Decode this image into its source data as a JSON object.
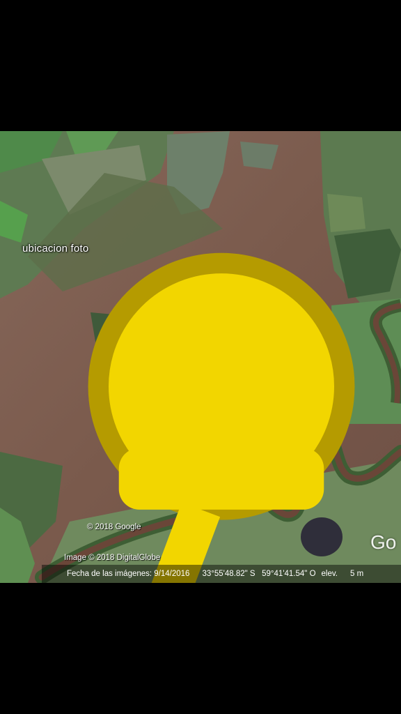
{
  "placemark": {
    "label": "ubicacion foto",
    "icon": "yellow-pushpin-icon"
  },
  "credits": {
    "google": "© 2018 Google",
    "imagery": "Image © 2018 DigitalGlobe"
  },
  "status_bar": {
    "date": "Fecha de las imágenes: 9/14/2016",
    "coordinates": "33°55'48.82\" S   59°41'41.54\" O",
    "elevation_label": "elev.",
    "altitude": "5 m"
  },
  "logo": "Go",
  "colors": {
    "background": "#000000",
    "flood_water": "#7a5c4e",
    "vegetation": "#4f6a45",
    "river": "#6a4638",
    "pin": "#f2d600"
  }
}
